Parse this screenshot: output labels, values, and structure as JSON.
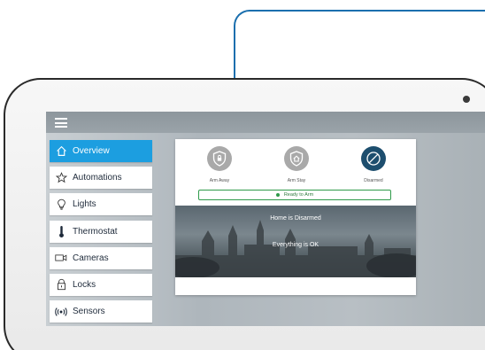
{
  "menu": {
    "items": [
      {
        "label": "Overview",
        "icon": "home-icon",
        "active": true
      },
      {
        "label": "Automations",
        "icon": "star-icon",
        "active": false
      },
      {
        "label": "Lights",
        "icon": "lightbulb-icon",
        "active": false
      },
      {
        "label": "Thermostat",
        "icon": "thermometer-icon",
        "active": false
      },
      {
        "label": "Cameras",
        "icon": "camera-icon",
        "active": false
      },
      {
        "label": "Locks",
        "icon": "lock-icon",
        "active": false
      },
      {
        "label": "Sensors",
        "icon": "wireless-signal-icon",
        "active": false
      }
    ]
  },
  "panel": {
    "modes": [
      {
        "label": "Arm Away",
        "selected": false
      },
      {
        "label": "Arm Stay",
        "selected": false
      },
      {
        "label": "Disarmed",
        "selected": true
      }
    ],
    "ready_label": "Ready to Arm",
    "status_title": "Home is Disarmed",
    "status_detail": "Everything is OK"
  },
  "colors": {
    "accent": "#1c9ee0",
    "ready_green": "#2f9a4a",
    "connector": "#1b6fae",
    "disarmed_circle": "#1d4e6e"
  }
}
